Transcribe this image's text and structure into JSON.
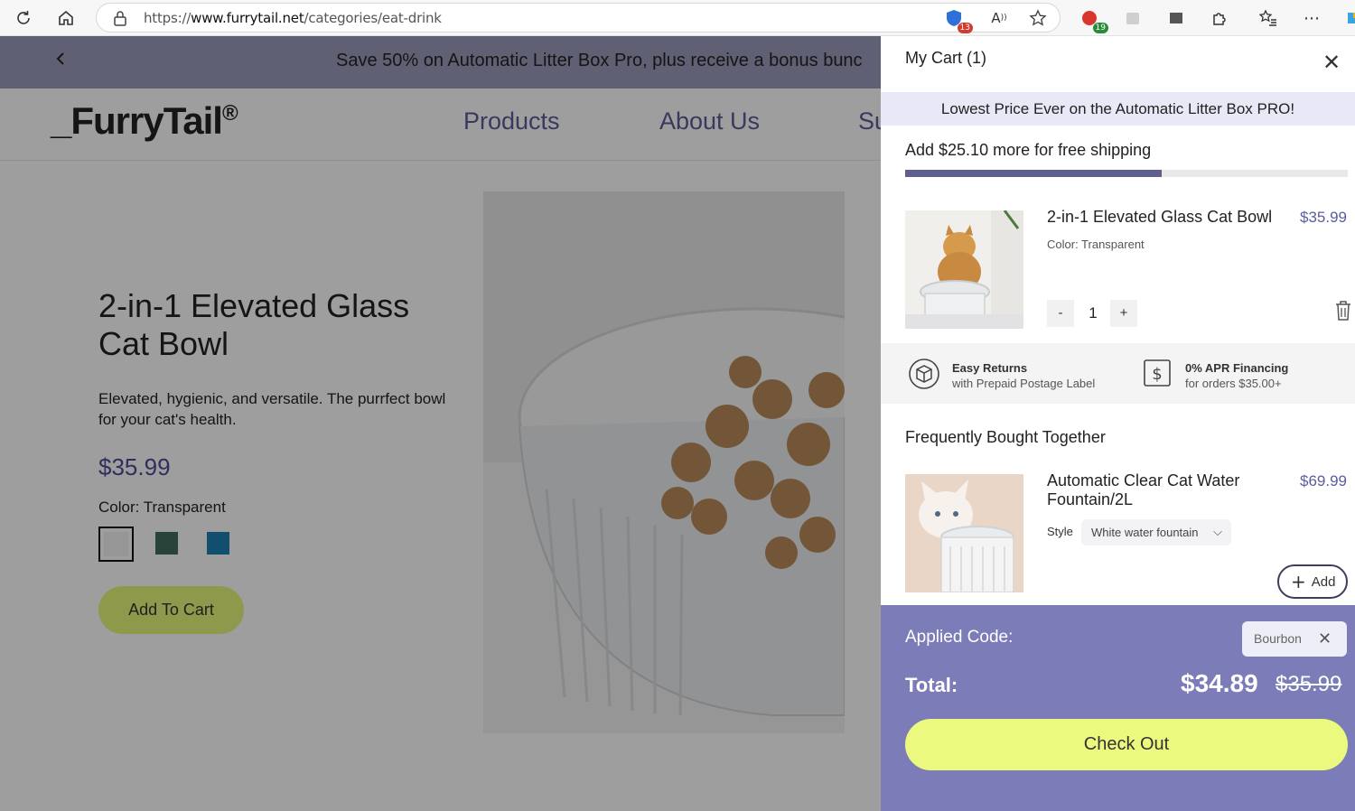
{
  "browser": {
    "url_prefix": "https://",
    "url_domain": "www.furrytail.net",
    "url_path": "/categories/eat-drink",
    "badge_1": "13",
    "badge_2": "19"
  },
  "page": {
    "promo_text": "Save 50% on Automatic Litter Box Pro, plus receive a bonus bunc",
    "logo": "_FurryTail",
    "logo_mark": "®",
    "nav": [
      "Products",
      "About Us",
      "Su"
    ],
    "product": {
      "title": "2-in-1 Elevated Glass Cat Bowl",
      "description": "Elevated, hygienic, and versatile. The purrfect bowl for your cat's health.",
      "price": "$35.99",
      "color_label": "Color: Transparent",
      "swatches": [
        {
          "name": "transparent",
          "color": "#f2f2f2",
          "selected": true
        },
        {
          "name": "dark-green",
          "color": "#3f6c5e",
          "selected": false
        },
        {
          "name": "blue",
          "color": "#1e7fb2",
          "selected": false
        }
      ],
      "add_to_cart": "Add To Cart"
    }
  },
  "cart": {
    "title": "My Cart (1)",
    "banner": "Lowest Price Ever on the Automatic Litter Box PRO!",
    "shipping_text": "Add $25.10 more for free shipping",
    "shipping_progress": 0.58,
    "item": {
      "name": "2-in-1 Elevated Glass Cat Bowl",
      "price": "$35.99",
      "color": "Color: Transparent",
      "minus": "-",
      "quantity": "1",
      "plus": "+"
    },
    "perks": [
      {
        "title": "Easy Returns",
        "subtitle": "with Prepaid Postage Label",
        "icon": "box-return-icon"
      },
      {
        "title": "0% APR Financing",
        "subtitle": "for orders $35.00+",
        "icon": "dollar-card-icon"
      }
    ],
    "fbt": {
      "title": "Frequently Bought Together",
      "name": "Automatic Clear Cat Water Fountain/2L",
      "price": "$69.99",
      "style_label": "Style",
      "style_value": "White water fountain",
      "add": "Add"
    },
    "summary": {
      "applied_label": "Applied Code:",
      "code": "Bourbon",
      "total_label": "Total:",
      "total_new": "$34.89",
      "total_old": "$35.99",
      "checkout": "Check Out"
    }
  }
}
